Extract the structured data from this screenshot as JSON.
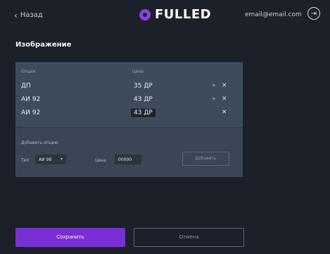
{
  "header": {
    "back_label": "Назад",
    "back_icon": "chevron-left-icon",
    "logo_text": "FULLED",
    "logo_color": "#8b3fe6",
    "user_email": "email@email.com",
    "exit_icon": "logout-icon"
  },
  "page": {
    "title": "Изображение"
  },
  "options": {
    "col_name": "Опция",
    "col_price": "Цена",
    "items": [
      {
        "name": "ДП",
        "price": "35 ДР",
        "cross": "+",
        "remove": "×"
      },
      {
        "name": "АИ 92",
        "price": "43 ДР",
        "cross": "+",
        "remove": "×"
      },
      {
        "name": "АИ 92",
        "price": "43 ДР",
        "cross": "",
        "remove": "×"
      }
    ]
  },
  "add_form": {
    "title": "Добавить опцию",
    "type_label": "Тип",
    "type_value": "АИ 98",
    "price_label": "Цена",
    "price_value": "00000",
    "add_button": "Добавить"
  },
  "footer": {
    "save_label": "Сохранить",
    "cancel_label": "Отмена",
    "accent": "#7a2fd6"
  }
}
